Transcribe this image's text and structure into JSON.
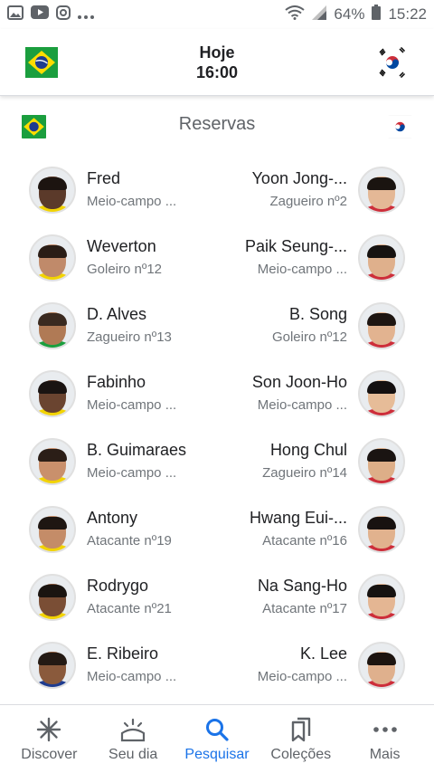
{
  "status_bar": {
    "battery": "64%",
    "time": "15:22",
    "icons": [
      "gallery-icon",
      "youtube-icon",
      "instagram-icon",
      "more-dots-icon",
      "wifi-icon",
      "signal-icon",
      "battery-icon"
    ]
  },
  "header": {
    "day": "Hoje",
    "time": "16:00",
    "home_flag": "brazil-flag",
    "away_flag": "korea-flag"
  },
  "section": {
    "title": "Reservas"
  },
  "rows": [
    {
      "left": {
        "name": "Fred",
        "role": "Meio-campo ..."
      },
      "right": {
        "name": "Yoon Jong-...",
        "role": "Zagueiro nº2"
      }
    },
    {
      "left": {
        "name": "Weverton",
        "role": "Goleiro nº12"
      },
      "right": {
        "name": "Paik Seung-...",
        "role": "Meio-campo ..."
      }
    },
    {
      "left": {
        "name": "D. Alves",
        "role": "Zagueiro nº13"
      },
      "right": {
        "name": "B. Song",
        "role": "Goleiro nº12"
      }
    },
    {
      "left": {
        "name": "Fabinho",
        "role": "Meio-campo ..."
      },
      "right": {
        "name": "Son Joon-Ho",
        "role": "Meio-campo ..."
      }
    },
    {
      "left": {
        "name": "B. Guimaraes",
        "role": "Meio-campo ..."
      },
      "right": {
        "name": "Hong Chul",
        "role": "Zagueiro nº14"
      }
    },
    {
      "left": {
        "name": "Antony",
        "role": "Atacante nº19"
      },
      "right": {
        "name": "Hwang Eui-...",
        "role": "Atacante nº16"
      }
    },
    {
      "left": {
        "name": "Rodrygo",
        "role": "Atacante nº21"
      },
      "right": {
        "name": "Na Sang-Ho",
        "role": "Atacante nº17"
      }
    },
    {
      "left": {
        "name": "E. Ribeiro",
        "role": "Meio-campo ..."
      },
      "right": {
        "name": "K. Lee",
        "role": "Meio-campo ..."
      }
    }
  ],
  "bottom_nav": [
    {
      "label": "Discover",
      "icon": "asterisk-icon",
      "active": false
    },
    {
      "label": "Seu dia",
      "icon": "sunrise-icon",
      "active": false
    },
    {
      "label": "Pesquisar",
      "icon": "search-icon",
      "active": true
    },
    {
      "label": "Coleções",
      "icon": "bookmarks-icon",
      "active": false
    },
    {
      "label": "Mais",
      "icon": "more-dots-icon",
      "active": false
    }
  ],
  "colors": {
    "accent": "#1a73e8",
    "text": "#202124",
    "secondary": "#70757a",
    "brazil_green": "#1b9e3e",
    "brazil_yellow": "#fedd00",
    "brazil_blue": "#1f3c8f",
    "korea_red": "#cd2e3a",
    "korea_blue": "#0047a0"
  }
}
